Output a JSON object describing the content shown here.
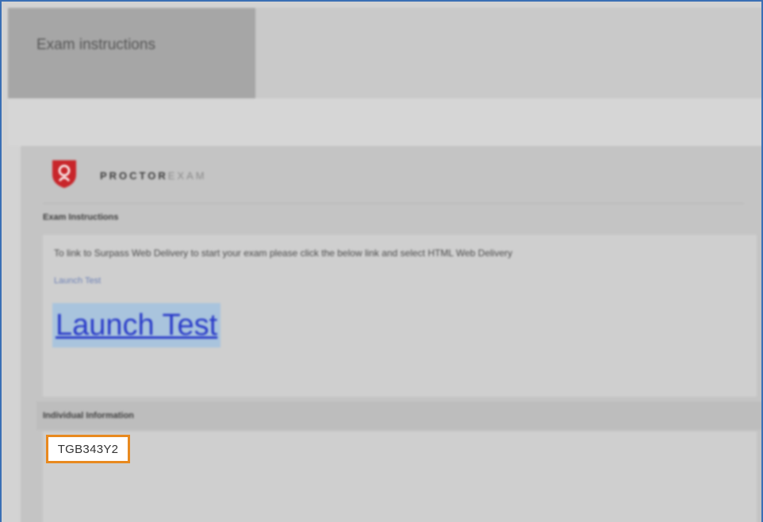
{
  "tabs": [
    {
      "label": "Exam instructions",
      "active": true
    }
  ],
  "brand": {
    "name_strong": "PROCTOR",
    "name_light": "EXAM",
    "color": "#c8262b"
  },
  "exam_instructions": {
    "heading": "Exam Instructions",
    "text": "To link to Surpass Web Delivery to start your exam please click the below link and select HTML Web Delivery",
    "small_link": "Launch Test",
    "big_link": "Launch Test"
  },
  "individual_information": {
    "heading": "Individual Information",
    "code": "TGB343Y2"
  },
  "colors": {
    "highlight_border": "#e8891f",
    "link": "#2a3bc9",
    "window_border": "#3a6fb5"
  }
}
